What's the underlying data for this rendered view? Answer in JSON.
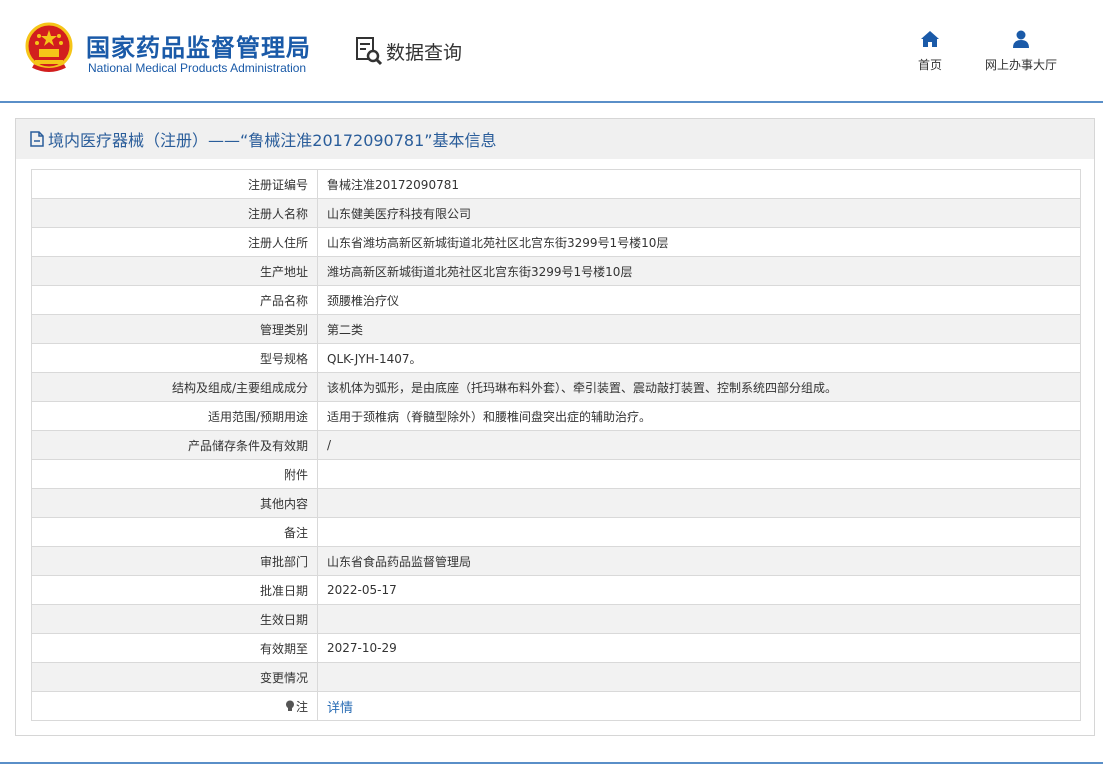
{
  "header": {
    "agency_cn": "国家药品监督管理局",
    "agency_en": "National Medical Products Administration",
    "section_title": "数据查询",
    "nav": [
      {
        "label": "首页",
        "icon": "home-icon"
      },
      {
        "label": "网上办事大厅",
        "icon": "user-icon"
      }
    ]
  },
  "panel": {
    "title": "境内医疗器械（注册）——“鲁械注准20172090781”基本信息",
    "icon": "document-icon"
  },
  "rows": [
    {
      "label": "注册证编号",
      "value": "鲁械注准20172090781"
    },
    {
      "label": "注册人名称",
      "value": "山东健美医疗科技有限公司"
    },
    {
      "label": "注册人住所",
      "value": "山东省潍坊高新区新城街道北苑社区北宫东街3299号1号楼10层"
    },
    {
      "label": "生产地址",
      "value": "潍坊高新区新城街道北苑社区北宫东街3299号1号楼10层"
    },
    {
      "label": "产品名称",
      "value": "颈腰椎治疗仪"
    },
    {
      "label": "管理类别",
      "value": "第二类"
    },
    {
      "label": "型号规格",
      "value": "QLK-JYH-1407。"
    },
    {
      "label": "结构及组成/主要组成成分",
      "value": "该机体为弧形，是由底座（托玛琳布料外套）、牵引装置、震动敲打装置、控制系统四部分组成。"
    },
    {
      "label": "适用范围/预期用途",
      "value": "适用于颈椎病（脊髓型除外）和腰椎间盘突出症的辅助治疗。"
    },
    {
      "label": "产品储存条件及有效期",
      "value": "/"
    },
    {
      "label": "附件",
      "value": ""
    },
    {
      "label": "其他内容",
      "value": ""
    },
    {
      "label": "备注",
      "value": ""
    },
    {
      "label": "审批部门",
      "value": "山东省食品药品监督管理局"
    },
    {
      "label": "批准日期",
      "value": "2022-05-17"
    },
    {
      "label": "生效日期",
      "value": ""
    },
    {
      "label": "有效期至",
      "value": "2027-10-29"
    },
    {
      "label": "变更情况",
      "value": ""
    }
  ],
  "note_row": {
    "label": "注",
    "link": "详情",
    "icon": "lightbulb-icon"
  },
  "colors": {
    "brand_blue": "#1a5aa8",
    "title_blue": "#2a5d9a",
    "link_blue": "#2a6db5",
    "emblem_red": "#d21e1e",
    "emblem_gold": "#f5c518"
  }
}
